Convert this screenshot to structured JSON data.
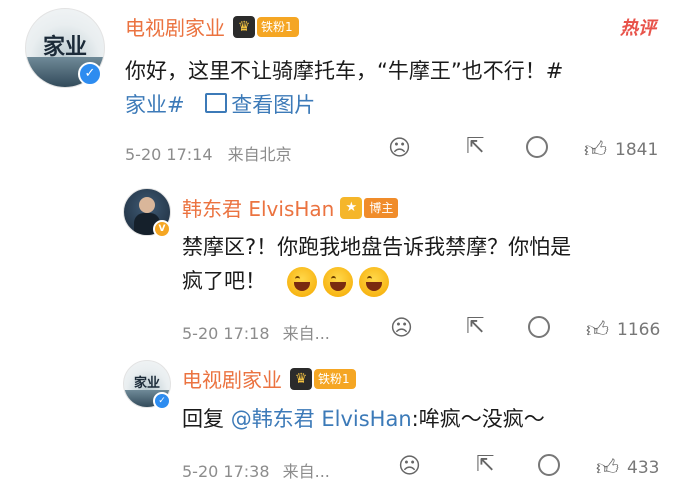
{
  "comments": [
    {
      "avatar_text": "家业",
      "name": "电视剧家业",
      "badge": "铁粉1",
      "hot_label": "热评",
      "text_line1": "你好，这里不让骑摩托车，“牛摩王”也不行！#",
      "hashtag": "家业#",
      "view_pic": "查看图片",
      "date": "5-20 17:14",
      "location": "来自北京",
      "likes": "1841"
    },
    {
      "name": "韩东君 ElvisHan",
      "badge": "博主",
      "text_line1": "禁摩区?！你跑我地盘告诉我禁摩？你怕是",
      "text_line2": "疯了吧！",
      "date": "5-20 17:18",
      "location": "来自...",
      "likes": "1166"
    },
    {
      "avatar_text": "家业",
      "name": "电视剧家业",
      "badge": "铁粉1",
      "reply_prefix": "回复 ",
      "mention": "@韩东君 ElvisHan",
      "reply_text": ":哞疯～没疯～",
      "date": "5-20 17:38",
      "location": "来自...",
      "likes": "433"
    }
  ]
}
